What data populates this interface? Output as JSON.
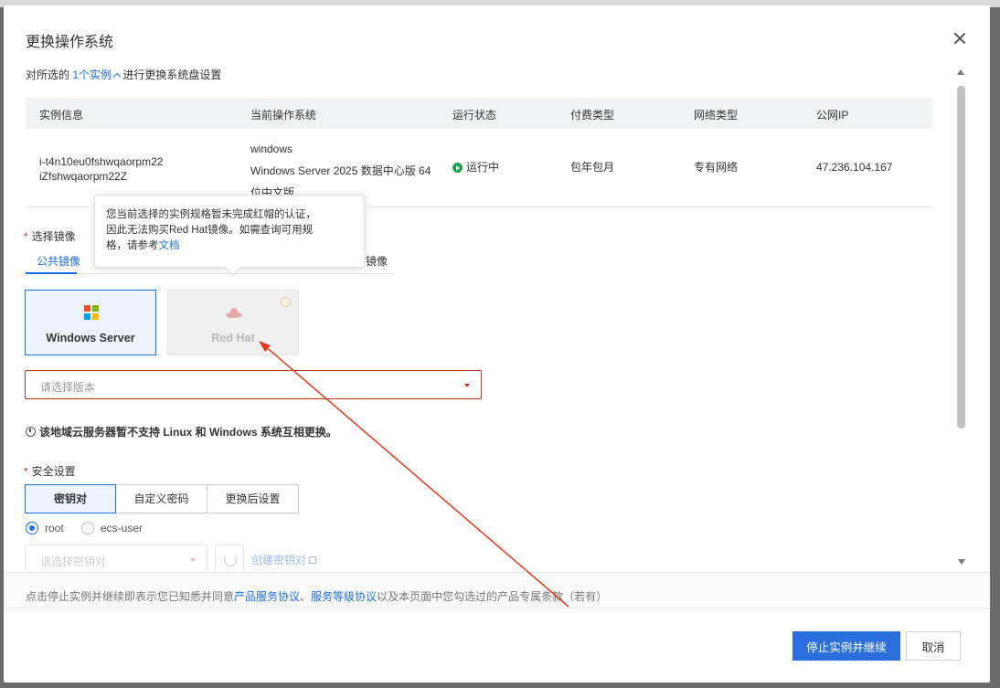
{
  "modal": {
    "title": "更换操作系统"
  },
  "subtitle": {
    "prefix": "对所选的",
    "instances_link": "1个实例",
    "suffix": "进行更换系统盘设置"
  },
  "table": {
    "headers": [
      "实例信息",
      "当前操作系统",
      "运行状态",
      "付费类型",
      "网络类型",
      "公网IP"
    ],
    "row": {
      "instance_id": "i-t4n10eu0fshwqaorpm22",
      "instance_name": "iZfshwqaorpm22Z",
      "os_name": "windows",
      "os_desc_1": "Windows Server 2025 数据中心版 64",
      "os_desc_2": "位中文版",
      "status": "运行中",
      "billing": "包年包月",
      "network": "专有网络",
      "public_ip": "47.236.104.167"
    }
  },
  "image_section": {
    "label": "选择镜像",
    "tabs": [
      "公共镜像",
      "镜像"
    ],
    "cards": [
      {
        "name": "Windows Server",
        "selected": true
      },
      {
        "name": "Red Hat",
        "disabled": true
      }
    ],
    "version_placeholder": "请选择版本",
    "warning": "该地域云服务器暂不支持 Linux 和 Windows 系统互相更换。"
  },
  "tooltip": {
    "line1": "您当前选择的实例规格暂未完成红帽的认证，",
    "line2": "因此无法购买Red Hat镜像。如需查询可用规",
    "line3_prefix": "格，请参考",
    "doc_link": "文档"
  },
  "security": {
    "label": "安全设置",
    "segments": [
      "密钥对",
      "自定义密码",
      "更换后设置"
    ],
    "radios": [
      "root",
      "ecs-user"
    ],
    "keypair_placeholder": "请选择密钥对",
    "create_keypair": "创建密钥对"
  },
  "footer": {
    "agreement_prefix": "点击停止实例并继续即表示您已知悉并同意",
    "link1": "产品服务协议",
    "sep": "、",
    "link2": "服务等级协议",
    "agreement_suffix": "以及本页面中您勾选过的产品专属条款（若有）",
    "primary_button": "停止实例并继续",
    "cancel_button": "取消"
  },
  "colors": {
    "accent": "#2b6fde",
    "running": "#1e9e48",
    "error_border": "#c8322b",
    "annotation_arrow": "#e03a1e"
  }
}
